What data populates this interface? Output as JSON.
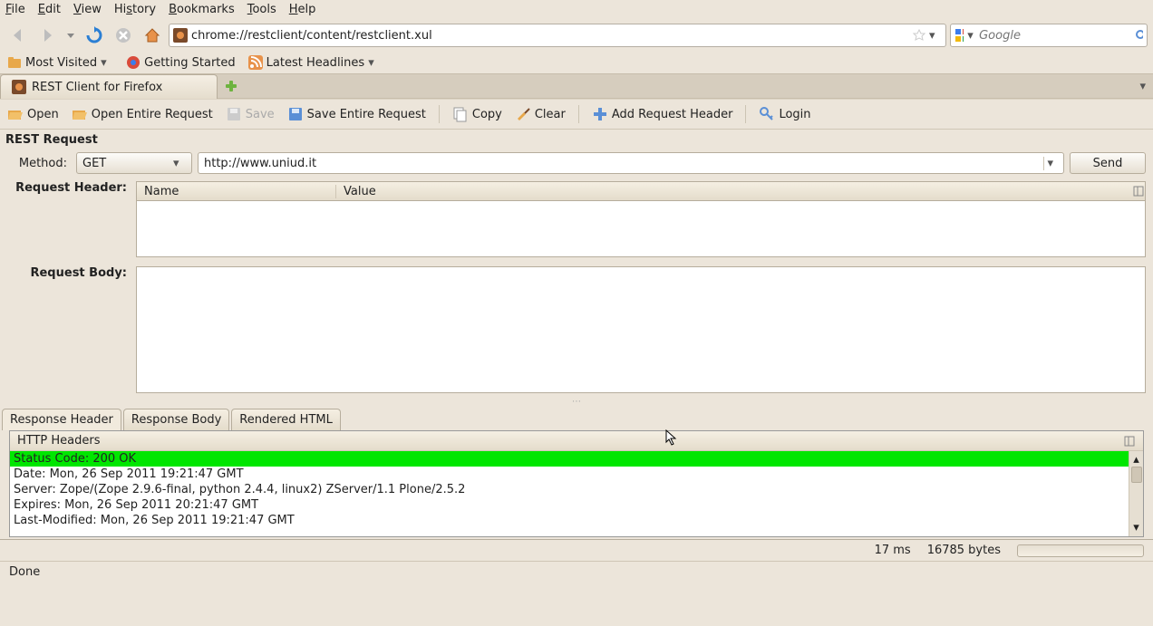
{
  "menubar": [
    "File",
    "Edit",
    "View",
    "History",
    "Bookmarks",
    "Tools",
    "Help"
  ],
  "nav": {
    "url": "chrome://restclient/content/restclient.xul",
    "search_placeholder": "Google"
  },
  "bookmarks": {
    "most_visited": "Most Visited",
    "getting_started": "Getting Started",
    "latest_headlines": "Latest Headlines"
  },
  "tab": {
    "title": "REST Client for Firefox"
  },
  "toolbar": {
    "open": "Open",
    "open_entire": "Open Entire Request",
    "save": "Save",
    "save_entire": "Save Entire Request",
    "copy": "Copy",
    "clear": "Clear",
    "add_header": "Add Request Header",
    "login": "Login"
  },
  "request": {
    "title": "REST Request",
    "method_label": "Method:",
    "method": "GET",
    "url": "http://www.uniud.it",
    "send": "Send",
    "header_label": "Request Header:",
    "th_name": "Name",
    "th_value": "Value",
    "body_label": "Request Body:"
  },
  "response": {
    "tabs": [
      "Response Header",
      "Response Body",
      "Rendered HTML"
    ],
    "headers_title": "HTTP Headers",
    "lines": [
      "Status Code: 200 OK",
      "Date: Mon, 26 Sep 2011 19:21:47 GMT",
      "Server: Zope/(Zope 2.9.6-final, python 2.4.4, linux2) ZServer/1.1 Plone/2.5.2",
      "Expires: Mon, 26 Sep 2011 20:21:47 GMT",
      "Last-Modified: Mon, 26 Sep 2011 19:21:47 GMT"
    ]
  },
  "status": {
    "time": "17 ms",
    "bytes": "16785 bytes",
    "done": "Done"
  }
}
